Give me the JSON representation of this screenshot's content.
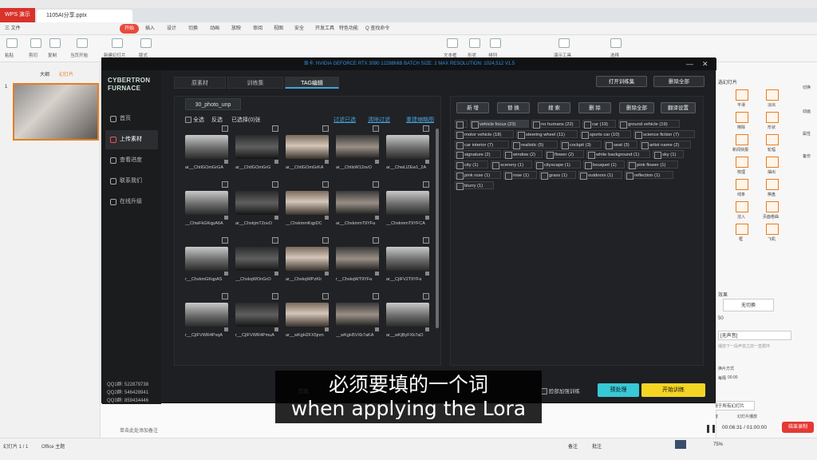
{
  "wps": {
    "logo": "WPS 演示",
    "doc_tab": "1105AI分享.pptx",
    "menu": {
      "file": "三 文件",
      "start": "开始",
      "insert": "插入",
      "design": "设计",
      "switch": "切换",
      "animate": "动画",
      "show": "放映",
      "review": "审阅",
      "view": "视图",
      "security": "安全",
      "dev": "开发工具",
      "special": "特色功能",
      "search": "Q 查找命令"
    },
    "ribbon": [
      "粘贴",
      "剪切",
      "复制",
      "格式刷",
      "当页开始",
      "新建幻灯片",
      "版式",
      "节",
      "文本框",
      "形状",
      "排列",
      "查找",
      "演示工具",
      "选择"
    ],
    "left": {
      "outline": "大纲",
      "slides": "幻灯片",
      "slide_no": "1"
    },
    "right": {
      "panel_title": "选幻灯片",
      "effects": [
        "平滑",
        "淡出",
        "擦除",
        "形状",
        "新闻快报",
        "轮辐",
        "梳理",
        "抽出",
        "线条",
        "棋盘",
        "溶入",
        "页面卷曲",
        "框",
        "飞机"
      ],
      "side": [
        "切换",
        "动画",
        "属性",
        "备份"
      ],
      "effect_label": "效果",
      "no_switch": "无切换",
      "speed": "速度",
      "speed_val": "50",
      "sound": "声音",
      "sound_val": "[无声音]",
      "play_next": "播放下一段声音之前一直循环",
      "switch_mode": "换片方式",
      "click": "单击鼠标时",
      "interval": "每隔",
      "interval_val": "00:00",
      "apply_all": "应用于所有幻灯片",
      "play": "播放",
      "slide_play": "幻灯片播放"
    },
    "notes": "单击此处添加备注",
    "status": {
      "slide": "幻灯片 1 / 1",
      "theme": "Office 主题",
      "notes": "备注",
      "comments": "批注",
      "zoom": "75%"
    },
    "recording": {
      "time": "00:06:31 / 01:00:00",
      "stop": "结束录制"
    }
  },
  "app": {
    "title": "显卡: NVIDIA GEFORCE RTX 3090 12288MiB  BATCH SIZE: 2  MAX RESOLUTION: 1024,512 V1.5",
    "brand_line1": "CYBERTRON FURNACE",
    "nav": [
      {
        "label": "首页"
      },
      {
        "label": "上传素材"
      },
      {
        "label": "查看进度"
      },
      {
        "label": "联系我们"
      },
      {
        "label": "在线升级"
      }
    ],
    "qq": [
      "QQ1群: 522879738",
      "QQ2群: 546428941",
      "QQ3群: 859434446"
    ],
    "tabs": [
      "原素材",
      "训练集",
      "TAG编辑"
    ],
    "top_buttons": {
      "open": "打开训练集",
      "delete_all": "删除全部"
    },
    "folder": "30_photo_unp",
    "controls": {
      "select_all": "全选",
      "invert": "反选",
      "selected": "已选择(0)张",
      "filter_selected": "过滤已选",
      "clear_filter": "清除过滤",
      "rebuild": "重建缩略图"
    },
    "thumbs": [
      "ar__ChtlGOmGrGA",
      "ar__ChtlGOmGrG",
      "ar__ChtlGOmGrKA",
      "ar__ChtlxW12ovO",
      "ar__ChwLlZEw1_2A",
      "__ChwFkGKqpA6A",
      "ar__ChxkjmT2ovO",
      "__ChxkmmKqpDC",
      "ar__ChxkmmT9YFa",
      "__ChxkmmT9YFCA",
      "r__ChxkmGKqpAS",
      "__ChxkqWOnGrO",
      "ar__ChxkqWPzKIr",
      "r__ChxkqWT9YFa",
      "ar__CjIFV2T9YFa",
      "r__CjIFVWR4PxqA",
      "r__CjIFVWR4PmuA",
      "ar__wKgH2FX5jnm",
      "__wKgH5VXk7aKA",
      "ar__wKjByFXk7aO"
    ],
    "tag_buttons": [
      "新 增",
      "替 换",
      "搜 索",
      "删 除",
      "删除全部",
      "翻译设置"
    ],
    "tags": [
      {
        "label": "",
        "sel": false
      },
      {
        "label": "vehicle focus  (23)",
        "sel": true
      },
      {
        "label": "no humans  (22)",
        "sel": false
      },
      {
        "label": "car  (19)",
        "sel": false
      },
      {
        "label": "ground vehicle  (19)",
        "sel": false
      },
      {
        "label": "motor vehicle  (18)",
        "sel": false
      },
      {
        "label": "steering wheel  (11)",
        "sel": false
      },
      {
        "label": "sports car  (10)",
        "sel": false
      },
      {
        "label": "science fiction  (7)",
        "sel": false
      },
      {
        "label": "car interior  (7)",
        "sel": false
      },
      {
        "label": "realistic  (5)",
        "sel": false
      },
      {
        "label": "cockpit  (3)",
        "sel": false
      },
      {
        "label": "seat  (3)",
        "sel": false
      },
      {
        "label": "artist name  (2)",
        "sel": false
      },
      {
        "label": "signature  (2)",
        "sel": false
      },
      {
        "label": "window  (2)",
        "sel": false
      },
      {
        "label": "flower  (2)",
        "sel": false
      },
      {
        "label": "white background  (1)",
        "sel": false
      },
      {
        "label": "sky  (1)",
        "sel": false
      },
      {
        "label": "city  (1)",
        "sel": false
      },
      {
        "label": "scenery  (1)",
        "sel": false
      },
      {
        "label": "cityscape  (1)",
        "sel": false
      },
      {
        "label": "bouquet  (1)",
        "sel": false
      },
      {
        "label": "pink flower  (1)",
        "sel": false
      },
      {
        "label": "pink rose  (1)",
        "sel": false
      },
      {
        "label": "rose  (1)",
        "sel": false
      },
      {
        "label": "grass  (1)",
        "sel": false
      },
      {
        "label": "outdoors  (1)",
        "sel": false
      },
      {
        "label": "reflection  (1)",
        "sel": false
      },
      {
        "label": "blurry  (1)",
        "sel": false
      }
    ],
    "bottom": {
      "cut_label": "剪裁",
      "check": "脸部加强训练",
      "preprocess": "预处理",
      "train": "开始训练"
    }
  },
  "subtitle": {
    "line1": "必须要填的一个词",
    "line2": "when applying the Lora"
  }
}
